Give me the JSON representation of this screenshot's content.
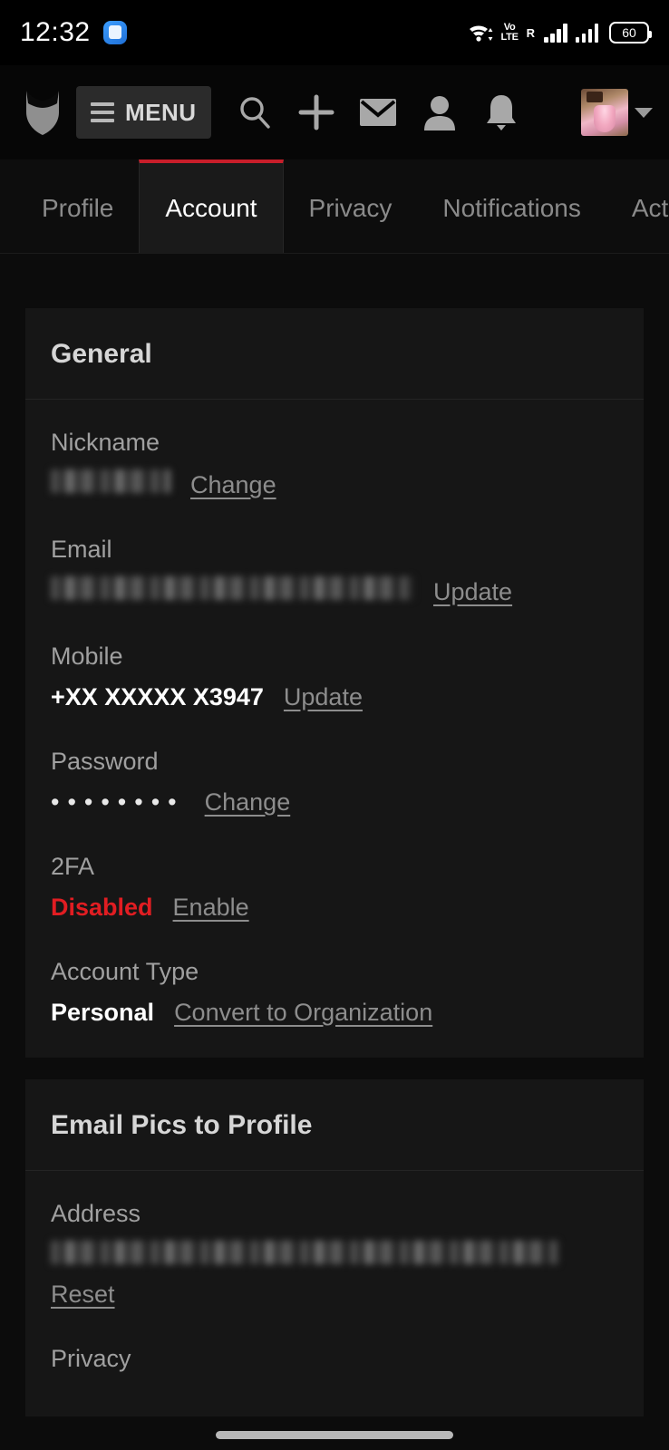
{
  "statusbar": {
    "time": "12:32",
    "app_icon": "message-icon",
    "wifi_icon": "wifi-icon",
    "volte_line1": "Vo",
    "volte_line2": "LTE",
    "roaming": "R",
    "battery_level": "60",
    "battery_icon": "battery-icon"
  },
  "appbar": {
    "logo_icon": "site-logo-icon",
    "menu_label": "MENU",
    "menu_icon": "hamburger-icon",
    "icons": [
      {
        "name": "search-icon",
        "glyph": "search"
      },
      {
        "name": "add-icon",
        "glyph": "plus"
      },
      {
        "name": "mail-icon",
        "glyph": "envelope"
      },
      {
        "name": "profile-icon",
        "glyph": "person"
      },
      {
        "name": "notifications-icon",
        "glyph": "bell"
      }
    ],
    "avatar_alt": "user-avatar",
    "caret_icon": "chevron-down-icon"
  },
  "tabs": [
    {
      "label": "Profile",
      "active": false
    },
    {
      "label": "Account",
      "active": true
    },
    {
      "label": "Privacy",
      "active": false
    },
    {
      "label": "Notifications",
      "active": false
    },
    {
      "label": "Activi",
      "active": false
    }
  ],
  "colors": {
    "accent_red": "#c81e2a",
    "danger_red": "#e11d22",
    "page_bg": "#0c0c0c",
    "card_bg": "#161616"
  },
  "cards": [
    {
      "title": "General",
      "fields": [
        {
          "label": "Nickname",
          "value": "",
          "redacted": true,
          "action": "Change"
        },
        {
          "label": "Email",
          "value": "",
          "redacted": true,
          "action": "Update"
        },
        {
          "label": "Mobile",
          "value": "+XX XXXXX X3947",
          "redacted": false,
          "action": "Update"
        },
        {
          "label": "Password",
          "value": "••••••••",
          "redacted": false,
          "action": "Change"
        },
        {
          "label": "2FA",
          "value": "Disabled",
          "redacted": false,
          "action": "Enable"
        },
        {
          "label": "Account Type",
          "value": "Personal",
          "redacted": false,
          "action": "Convert to Organization"
        }
      ]
    },
    {
      "title": "Email Pics to Profile",
      "fields": [
        {
          "label": "Address",
          "value": "",
          "redacted": true,
          "action": "Reset"
        },
        {
          "label": "Privacy",
          "value": "",
          "redacted": false,
          "action": ""
        }
      ]
    }
  ]
}
